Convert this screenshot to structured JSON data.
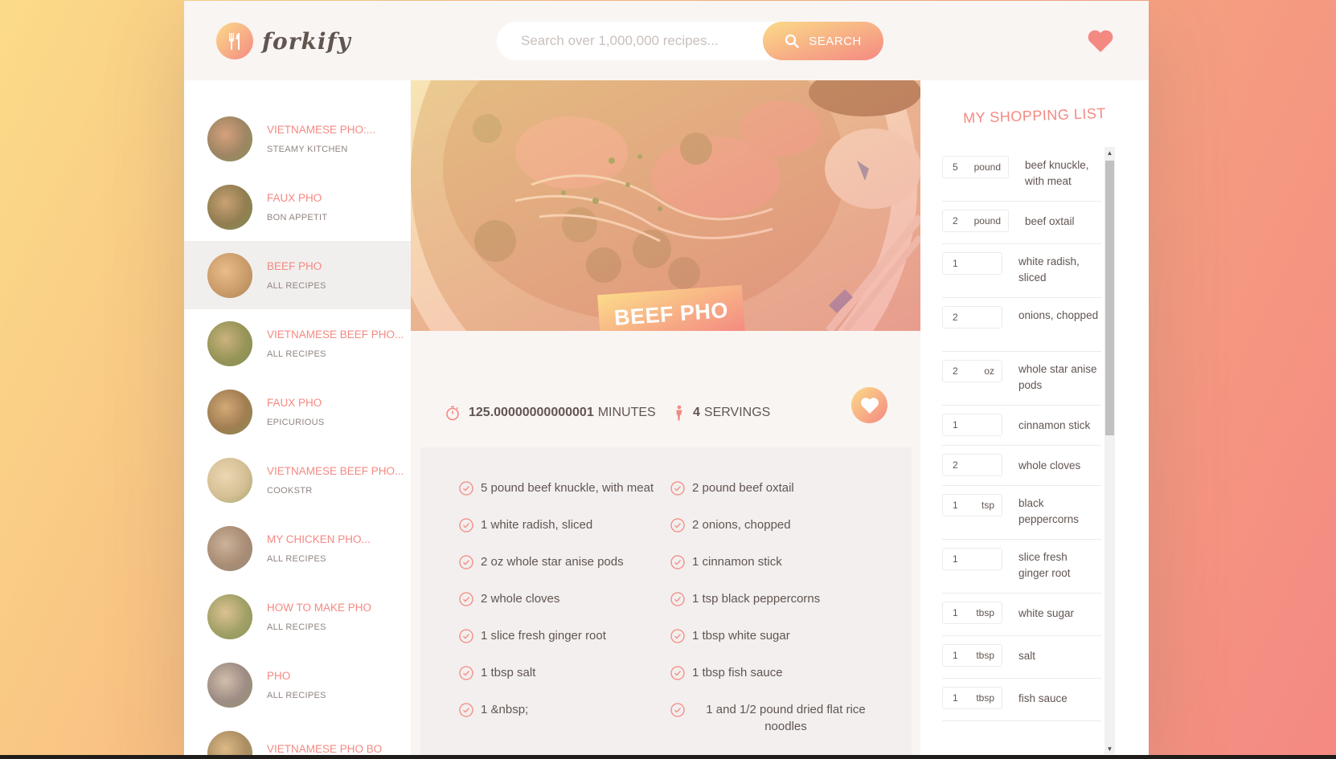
{
  "header": {
    "logo_text": "forkify",
    "search_placeholder": "Search over 1,000,000 recipes...",
    "search_label": "SEARCH"
  },
  "results": [
    {
      "title": "VIETNAMESE PHO:...",
      "author": "STEAMY KITCHEN",
      "active": false
    },
    {
      "title": "FAUX PHO",
      "author": "BON APPETIT",
      "active": false
    },
    {
      "title": "BEEF PHO",
      "author": "ALL RECIPES",
      "active": true
    },
    {
      "title": "VIETNAMESE BEEF PHO...",
      "author": "ALL RECIPES",
      "active": false
    },
    {
      "title": "FAUX PHO",
      "author": "EPICURIOUS",
      "active": false
    },
    {
      "title": "VIETNAMESE BEEF PHO...",
      "author": "COOKSTR",
      "active": false
    },
    {
      "title": "MY CHICKEN PHO...",
      "author": "ALL RECIPES",
      "active": false
    },
    {
      "title": "HOW TO MAKE PHO",
      "author": "ALL RECIPES",
      "active": false
    },
    {
      "title": "PHO",
      "author": "ALL RECIPES",
      "active": false
    },
    {
      "title": "VIETNAMESE PHO BO",
      "author": "",
      "active": false
    }
  ],
  "recipe": {
    "title": "BEEF PHO",
    "minutes_value": "125.00000000000001",
    "minutes_label": "MINUTES",
    "servings_value": "4",
    "servings_label": "SERVINGS",
    "ingredients": [
      "5 pound beef knuckle, with meat",
      "2 pound beef oxtail",
      "1 white radish, sliced",
      "2 onions, chopped",
      "2 oz whole star anise pods",
      "1 cinnamon stick",
      "2 whole cloves",
      "1 tsp black peppercorns",
      "1 slice fresh ginger root",
      "1 tbsp white sugar",
      "1 tbsp salt",
      "1 tbsp fish sauce",
      "1 &nbsp;",
      "1 and 1/2 pound dried flat rice noodles"
    ]
  },
  "shopping": {
    "title": "MY SHOPPING LIST",
    "items": [
      {
        "count": "5",
        "unit": "pound",
        "desc": "beef knuckle, with meat"
      },
      {
        "count": "2",
        "unit": "pound",
        "desc": "beef oxtail"
      },
      {
        "count": "1",
        "unit": "",
        "desc": "white radish, sliced"
      },
      {
        "count": "2",
        "unit": "",
        "desc": "onions, chopped"
      },
      {
        "count": "2",
        "unit": "oz",
        "desc": "whole star anise pods"
      },
      {
        "count": "1",
        "unit": "",
        "desc": "cinnamon stick"
      },
      {
        "count": "2",
        "unit": "",
        "desc": "whole cloves"
      },
      {
        "count": "1",
        "unit": "tsp",
        "desc": "black peppercorns"
      },
      {
        "count": "1",
        "unit": "",
        "desc": "slice fresh ginger root"
      },
      {
        "count": "1",
        "unit": "tbsp",
        "desc": "white sugar"
      },
      {
        "count": "1",
        "unit": "tbsp",
        "desc": "salt"
      },
      {
        "count": "1",
        "unit": "tbsp",
        "desc": "fish sauce"
      }
    ]
  },
  "colors": {
    "accent": "#f48982",
    "accent_light": "#fbdb89",
    "text": "#615551"
  }
}
